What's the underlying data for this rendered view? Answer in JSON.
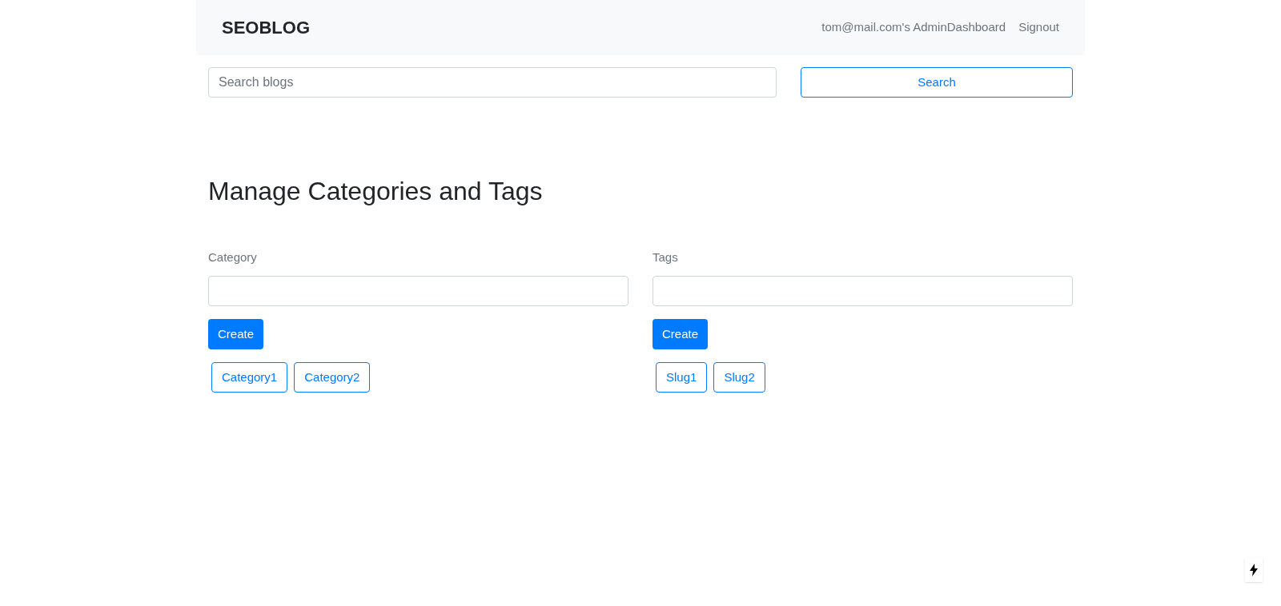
{
  "navbar": {
    "brand": "SEOBLOG",
    "links": [
      "tom@mail.com's AdminDashboard",
      "Signout"
    ]
  },
  "search": {
    "placeholder": "Search blogs",
    "button": "Search"
  },
  "heading": "Manage Categories and Tags",
  "panels": [
    {
      "label": "Category",
      "button": "Create",
      "items": [
        "Category1",
        "Category2"
      ]
    },
    {
      "label": "Tags",
      "button": "Create",
      "items": [
        "Slug1",
        "Slug2"
      ]
    }
  ]
}
